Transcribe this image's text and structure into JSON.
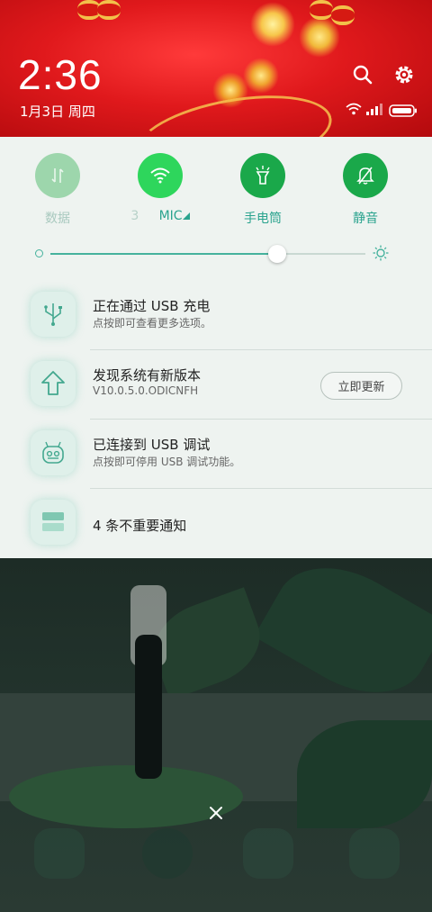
{
  "header": {
    "time": "2:36",
    "date": "1月3日 周四"
  },
  "toggles": [
    {
      "label": "数据",
      "icon": "data-arrows-icon",
      "state": "off"
    },
    {
      "label_faded": "3",
      "label": "MIC",
      "icon": "wifi-icon",
      "state": "on"
    },
    {
      "label": "手电筒",
      "icon": "flashlight-icon",
      "state": "on"
    },
    {
      "label": "静音",
      "icon": "silent-bell-icon",
      "state": "on"
    }
  ],
  "brightness": {
    "level": 0.72
  },
  "notifications": [
    {
      "title": "正在通过 USB 充电",
      "subtitle": "点按即可查看更多选项。",
      "icon": "usb-icon"
    },
    {
      "title": "发现系统有新版本",
      "subtitle": "V10.0.5.0.ODICNFH",
      "icon": "update-arrow-icon",
      "action": "立即更新"
    },
    {
      "title": "已连接到 USB 调试",
      "subtitle": "点按即可停用 USB 调试功能。",
      "icon": "android-debug-icon"
    },
    {
      "title": "4 条不重要通知",
      "icon": "stack-icon"
    }
  ],
  "colors": {
    "accent": "#45b29d",
    "toggle_on": "#1aa84a",
    "header_red": "#e0191c"
  }
}
